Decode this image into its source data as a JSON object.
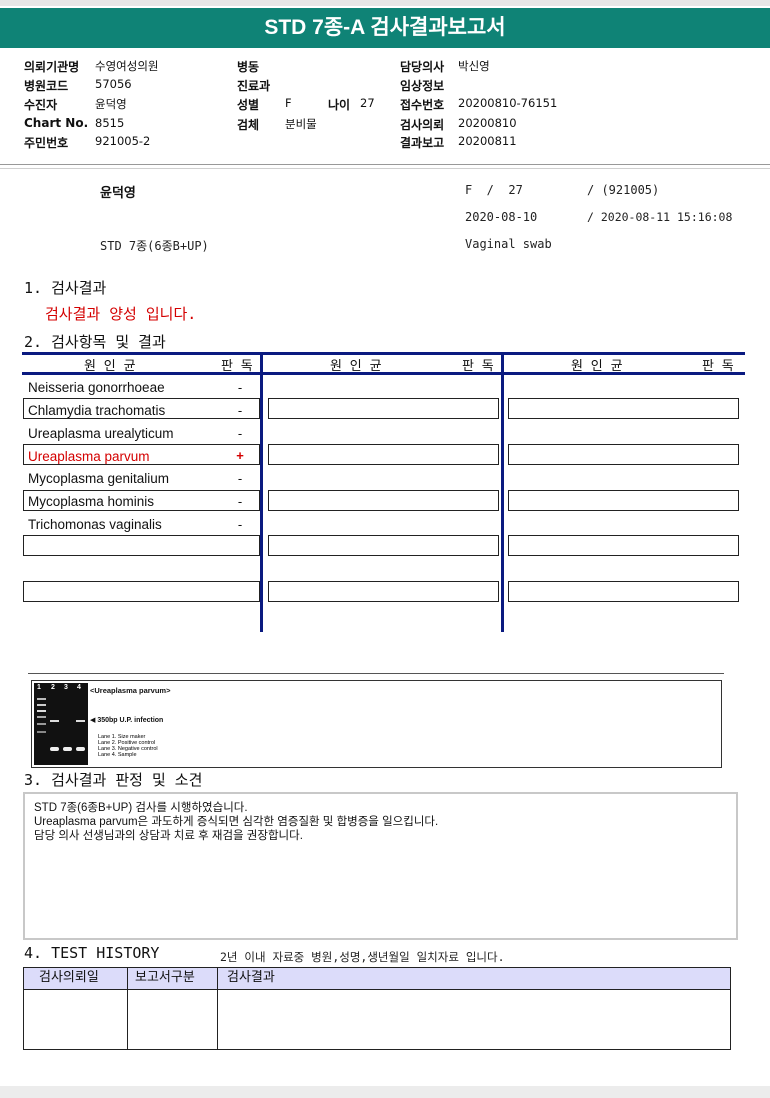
{
  "title": "STD 7종-A 검사결과보고서",
  "header": {
    "col1": [
      {
        "label": "의뢰기관명",
        "value": "수영여성의원"
      },
      {
        "label": "병원코드",
        "value": "57056"
      },
      {
        "label": "수진자",
        "value": "윤덕영"
      },
      {
        "label": "Chart No.",
        "value": "8515"
      },
      {
        "label": "주민번호",
        "value": "921005-2"
      }
    ],
    "col2": [
      {
        "label": "병동",
        "value": ""
      },
      {
        "label": "진료과",
        "value": ""
      },
      {
        "label": "성별",
        "value": "F"
      },
      {
        "label": "검체",
        "value": "분비물"
      }
    ],
    "age": {
      "label": "나이",
      "value": "27"
    },
    "col3": [
      {
        "label": "담당의사",
        "value": "박신영"
      },
      {
        "label": "임상정보",
        "value": ""
      },
      {
        "label": "접수번호",
        "value": "20200810-76151"
      },
      {
        "label": "검사의뢰",
        "value": "20200810"
      },
      {
        "label": "결과보고",
        "value": "20200811"
      }
    ]
  },
  "summary": {
    "name": "윤덕영",
    "sex_age": "F  /  27",
    "birth": "/ (921005)",
    "receipt_date": "2020-08-10",
    "report_datetime": "/ 2020-08-11 15:16:08",
    "test_name": "STD 7종(6종B+UP)",
    "specimen": "Vaginal swab"
  },
  "section1": {
    "heading": "1. 검사결과",
    "result": "검사결과 양성 입니다."
  },
  "section2": {
    "heading": "2. 검사항목 및 결과",
    "col_header_organism": "원 인 균",
    "col_header_result": "판 독",
    "rows": [
      {
        "name": "Neisseria gonorrhoeae",
        "result": "-",
        "positive": false
      },
      {
        "name": "Chlamydia trachomatis",
        "result": "-",
        "positive": false
      },
      {
        "name": "Ureaplasma urealyticum",
        "result": "-",
        "positive": false
      },
      {
        "name": "Ureaplasma parvum",
        "result": "+",
        "positive": true
      },
      {
        "name": "Mycoplasma genitalium",
        "result": "-",
        "positive": false
      },
      {
        "name": "Mycoplasma hominis",
        "result": "-",
        "positive": false
      },
      {
        "name": "Trichomonas vaginalis",
        "result": "-",
        "positive": false
      }
    ]
  },
  "gel": {
    "lane_numbers": [
      "1",
      "2",
      "3",
      "4"
    ],
    "title": "<Ureaplasma parvum>",
    "band_label": "350bp U.P. infection",
    "lanes": [
      "Lane 1. Size maker",
      "Lane 2. Positive control",
      "Lane 3. Negative control",
      "Lane 4. Sample"
    ]
  },
  "section3": {
    "heading": "3. 검사결과 판정 및 소견",
    "lines": [
      "STD 7종(6종B+UP) 검사를 시행하였습니다.",
      "Ureaplasma parvum은  과도하게 증식되면 심각한 염증질환 및 합병증을 일으킵니다.",
      "담당 의사 선생님과의 상담과 치료 후 재검을 권장합니다."
    ]
  },
  "section4": {
    "heading": "4. TEST HISTORY",
    "note": "2년 이내 자료중 병원,성명,생년월일 일치자료 입니다.",
    "columns": [
      "검사의뢰일",
      "보고서구분",
      "검사결과"
    ]
  },
  "colors": {
    "title_bg": "#0f8376",
    "navy": "#0a1a80",
    "positive": "#d40000",
    "history_header_bg": "#dcdcfa"
  }
}
